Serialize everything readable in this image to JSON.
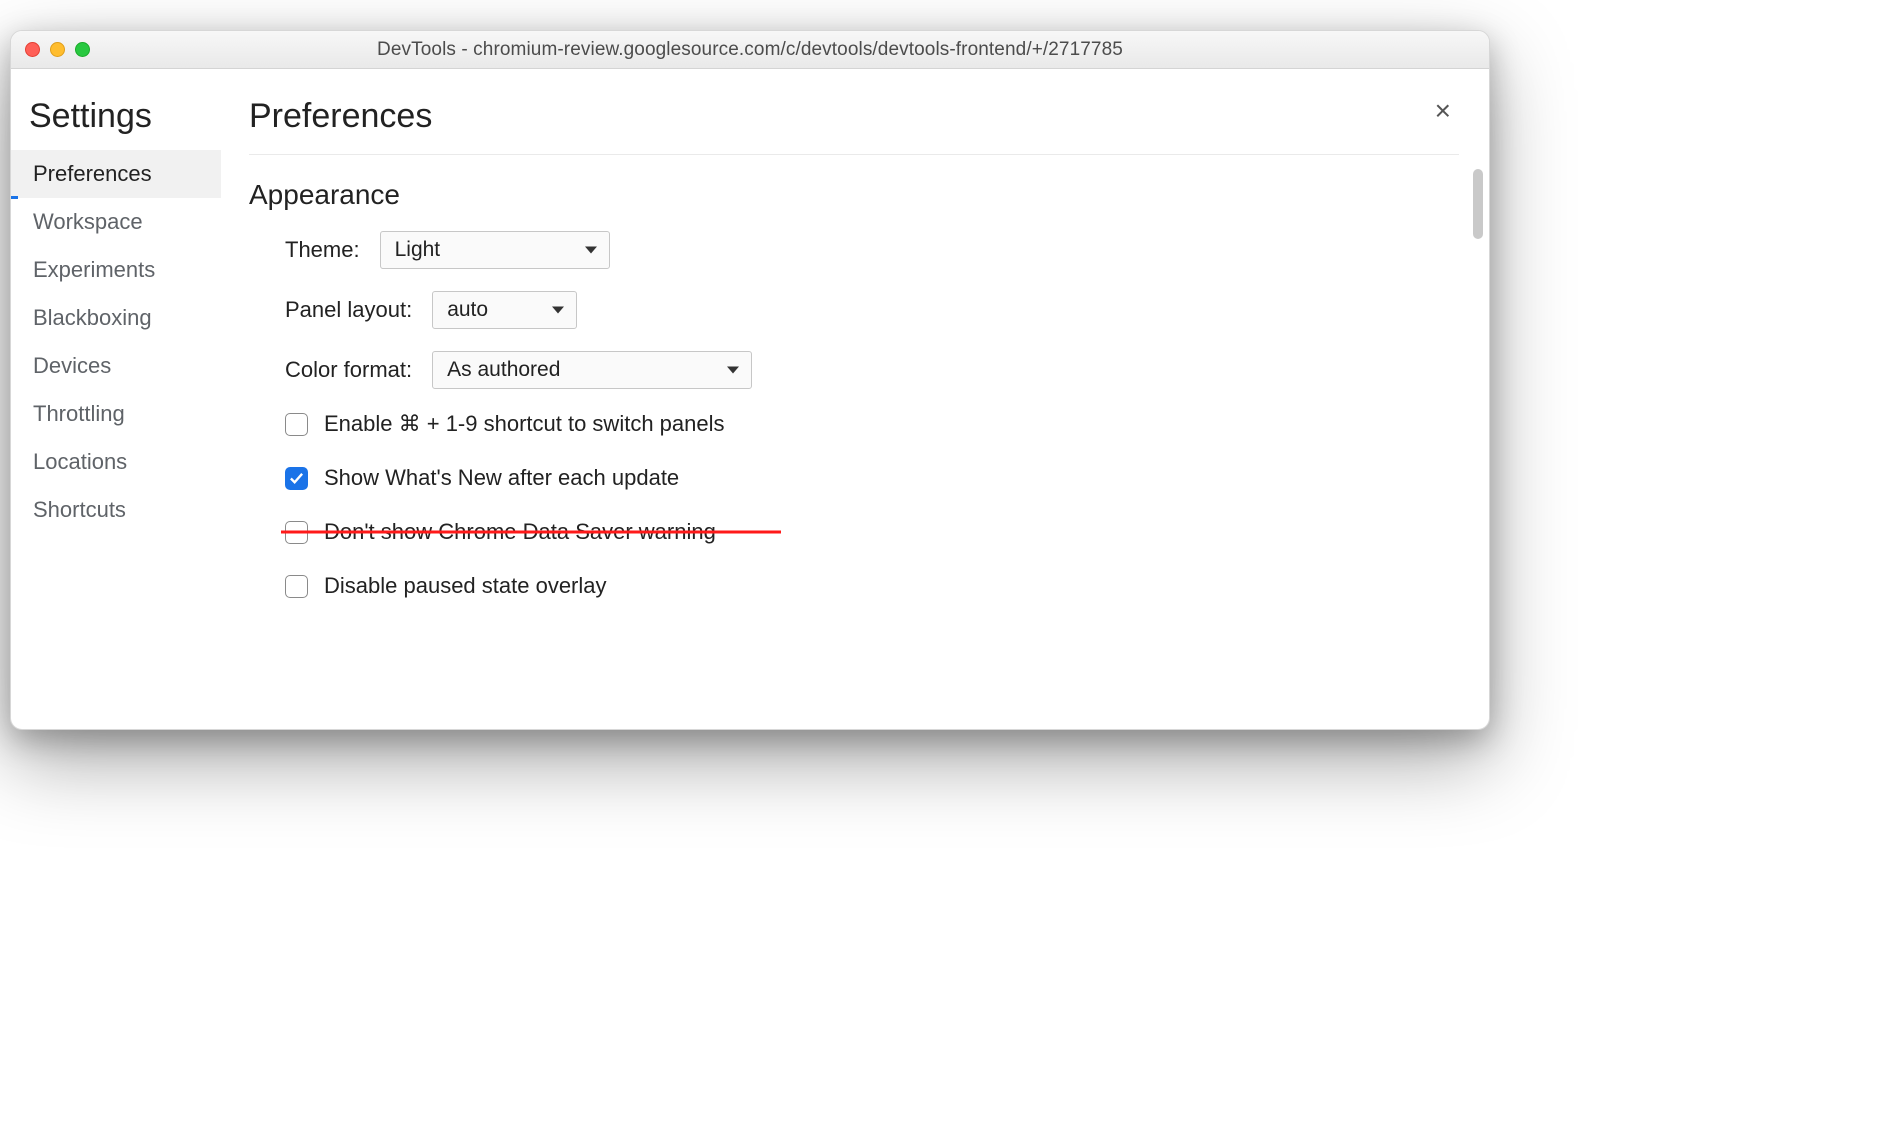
{
  "window": {
    "title": "DevTools - chromium-review.googlesource.com/c/devtools/devtools-frontend/+/2717785"
  },
  "sidebar": {
    "heading": "Settings",
    "items": [
      {
        "label": "Preferences",
        "active": true
      },
      {
        "label": "Workspace"
      },
      {
        "label": "Experiments"
      },
      {
        "label": "Blackboxing"
      },
      {
        "label": "Devices"
      },
      {
        "label": "Throttling"
      },
      {
        "label": "Locations"
      },
      {
        "label": "Shortcuts"
      }
    ]
  },
  "content": {
    "heading": "Preferences",
    "section": "Appearance",
    "theme_label": "Theme:",
    "theme_value": "Light",
    "panel_label": "Panel layout:",
    "panel_value": "auto",
    "color_label": "Color format:",
    "color_value": "As authored",
    "checkboxes": [
      {
        "label": "Enable ⌘ + 1-9 shortcut to switch panels",
        "checked": false,
        "struck": false
      },
      {
        "label": "Show What's New after each update",
        "checked": true,
        "struck": false
      },
      {
        "label": "Don't show Chrome Data Saver warning",
        "checked": false,
        "struck": true
      },
      {
        "label": "Disable paused state overlay",
        "checked": false,
        "struck": false
      }
    ]
  }
}
